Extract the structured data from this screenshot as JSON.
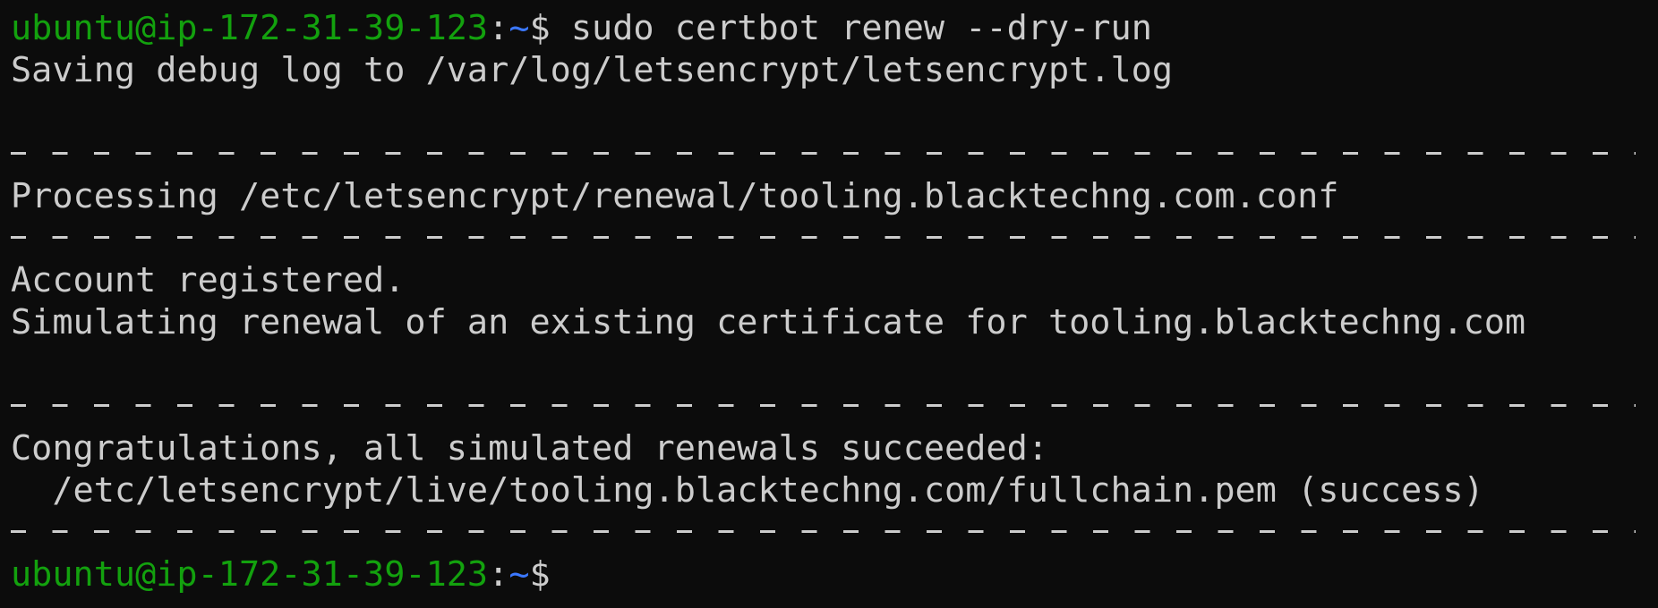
{
  "prompt": {
    "user_host": "ubuntu@ip-172-31-39-123",
    "separator": ":",
    "path": "~",
    "symbol": "$"
  },
  "command": " sudo certbot renew --dry-run",
  "output": {
    "saving_log": "Saving debug log to /var/log/letsencrypt/letsencrypt.log",
    "processing": "Processing /etc/letsencrypt/renewal/tooling.blacktechng.com.conf",
    "account_registered": "Account registered.",
    "simulating": "Simulating renewal of an existing certificate for tooling.blacktechng.com",
    "congratulations": "Congratulations, all simulated renewals succeeded:",
    "fullchain": "  /etc/letsencrypt/live/tooling.blacktechng.com/fullchain.pem (success)"
  },
  "colors": {
    "background": "#0c0c0c",
    "text": "#cccccc",
    "user_host": "#13a10e",
    "path": "#3b78ff"
  }
}
